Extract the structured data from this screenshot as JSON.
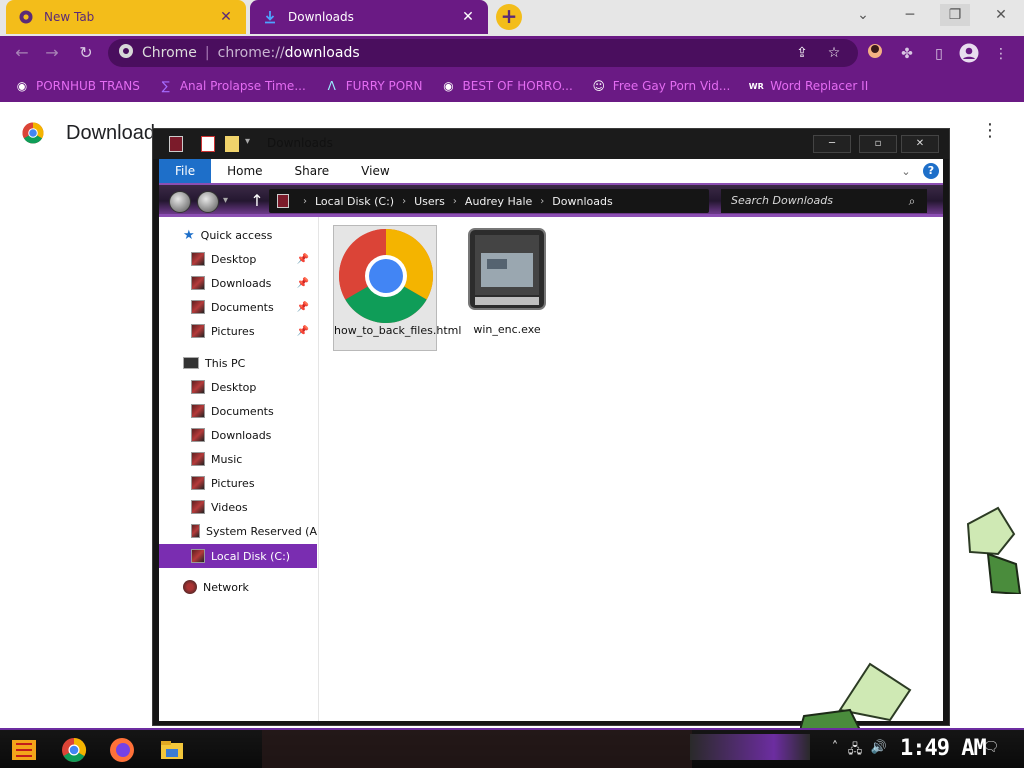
{
  "tabs": [
    {
      "label": "New Tab",
      "active": false
    },
    {
      "label": "Downloads",
      "active": true
    }
  ],
  "omnibox": {
    "site_name": "Chrome",
    "url_scheme": "chrome://",
    "url_host": "downloads"
  },
  "bookmarks": [
    {
      "label": "PORNHUB TRANS",
      "icon": "globe-icon"
    },
    {
      "label": "Anal Prolapse Time...",
      "icon": "bookmark-flag-icon"
    },
    {
      "label": "FURRY PORN",
      "icon": "lambda-icon"
    },
    {
      "label": "BEST OF HORRO...",
      "icon": "globe-icon"
    },
    {
      "label": "Free Gay Porn Vid...",
      "icon": "mascot-icon"
    },
    {
      "label": "Word Replacer II",
      "icon": "wr-icon"
    }
  ],
  "downloads_page": {
    "title": "Download"
  },
  "explorer": {
    "title": "Downloads",
    "ribbon_tabs": [
      "File",
      "Home",
      "Share",
      "View"
    ],
    "breadcrumb": [
      "Local Disk (C:)",
      "Users",
      "Audrey Hale",
      "Downloads"
    ],
    "search_placeholder": "Search Downloads",
    "quick_access_label": "Quick access",
    "quick_access": [
      {
        "label": "Desktop",
        "pinned": true
      },
      {
        "label": "Downloads",
        "pinned": true
      },
      {
        "label": "Documents",
        "pinned": true
      },
      {
        "label": "Pictures",
        "pinned": true
      }
    ],
    "this_pc_label": "This PC",
    "this_pc": [
      {
        "label": "Desktop"
      },
      {
        "label": "Documents"
      },
      {
        "label": "Downloads"
      },
      {
        "label": "Music"
      },
      {
        "label": "Pictures"
      },
      {
        "label": "Videos"
      },
      {
        "label": "System Reserved (A"
      },
      {
        "label": "Local Disk (C:)",
        "selected": true
      }
    ],
    "network_label": "Network",
    "files": [
      {
        "name": "how_to_back_files.html",
        "icon": "chrome-icon",
        "selected": true
      },
      {
        "name": "win_enc.exe",
        "icon": "exe-window-icon",
        "selected": false
      }
    ]
  },
  "taskbar": {
    "clock": "1:49 AM",
    "apps": [
      "start-icon",
      "chrome-icon",
      "firefox-icon",
      "file-explorer-icon"
    ]
  },
  "colors": {
    "chrome_purple": "#6a1a84",
    "tab_yellow": "#f3bd1a",
    "bookmark_pink": "#e46cf2",
    "file_tab_blue": "#1e6fc9",
    "selection_purple": "#7a2db1"
  }
}
